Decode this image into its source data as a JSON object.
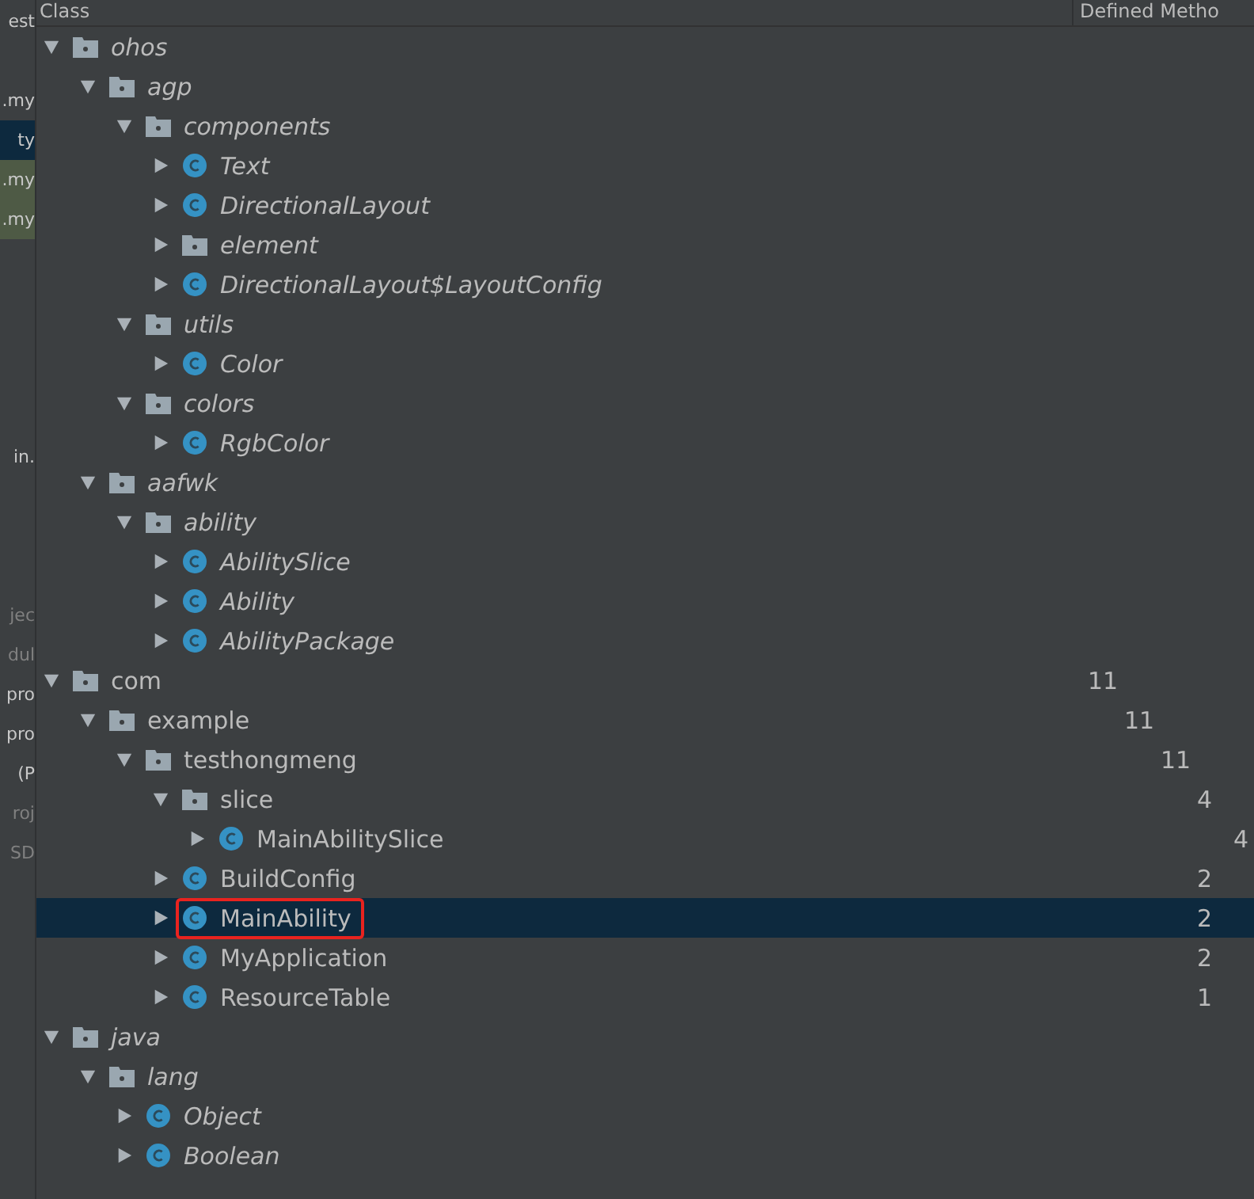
{
  "side_panel": {
    "items": [
      {
        "text": "est",
        "selected": false,
        "modified": false,
        "dim": false
      },
      {
        "text": ".my",
        "selected": false,
        "modified": false,
        "dim": false
      },
      {
        "text": "ty",
        "selected": true,
        "modified": false,
        "dim": false
      },
      {
        "text": ".my",
        "selected": false,
        "modified": true,
        "dim": false
      },
      {
        "text": ".my",
        "selected": false,
        "modified": true,
        "dim": false
      },
      {
        "text": "in.",
        "selected": false,
        "modified": false,
        "dim": false
      },
      {
        "text": "jec",
        "selected": false,
        "modified": false,
        "dim": true
      },
      {
        "text": "dul",
        "selected": false,
        "modified": false,
        "dim": true
      },
      {
        "text": "pro",
        "selected": false,
        "modified": false,
        "dim": false
      },
      {
        "text": "pro",
        "selected": false,
        "modified": false,
        "dim": false
      },
      {
        "text": "(P",
        "selected": false,
        "modified": false,
        "dim": false
      },
      {
        "text": "roj",
        "selected": false,
        "modified": false,
        "dim": true
      },
      {
        "text": "SD",
        "selected": false,
        "modified": false,
        "dim": true
      }
    ]
  },
  "table": {
    "columns": [
      "Class",
      "Defined Metho"
    ],
    "tree": [
      {
        "kind": "package",
        "name": "ohos",
        "italic": true,
        "expanded": true,
        "selected": false,
        "children": [
          {
            "kind": "package",
            "name": "agp",
            "italic": true,
            "expanded": true,
            "selected": false,
            "children": [
              {
                "kind": "package",
                "name": "components",
                "italic": true,
                "expanded": true,
                "selected": false,
                "children": [
                  {
                    "kind": "class",
                    "name": "Text",
                    "italic": true,
                    "expanded": false,
                    "selected": false
                  },
                  {
                    "kind": "class",
                    "name": "DirectionalLayout",
                    "italic": true,
                    "expanded": false,
                    "selected": false
                  },
                  {
                    "kind": "package",
                    "name": "element",
                    "italic": true,
                    "expanded": false,
                    "selected": false
                  },
                  {
                    "kind": "class",
                    "name": "DirectionalLayout$LayoutConfig",
                    "italic": true,
                    "expanded": false,
                    "selected": false
                  }
                ]
              },
              {
                "kind": "package",
                "name": "utils",
                "italic": true,
                "expanded": true,
                "selected": false,
                "children": [
                  {
                    "kind": "class",
                    "name": "Color",
                    "italic": true,
                    "expanded": false,
                    "selected": false
                  }
                ]
              },
              {
                "kind": "package",
                "name": "colors",
                "italic": true,
                "expanded": true,
                "selected": false,
                "children": [
                  {
                    "kind": "class",
                    "name": "RgbColor",
                    "italic": true,
                    "expanded": false,
                    "selected": false
                  }
                ]
              }
            ]
          },
          {
            "kind": "package",
            "name": "aafwk",
            "italic": true,
            "expanded": true,
            "selected": false,
            "children": [
              {
                "kind": "package",
                "name": "ability",
                "italic": true,
                "expanded": true,
                "selected": false,
                "children": [
                  {
                    "kind": "class",
                    "name": "AbilitySlice",
                    "italic": true,
                    "expanded": false,
                    "selected": false
                  },
                  {
                    "kind": "class",
                    "name": "Ability",
                    "italic": true,
                    "expanded": false,
                    "selected": false
                  },
                  {
                    "kind": "class",
                    "name": "AbilityPackage",
                    "italic": true,
                    "expanded": false,
                    "selected": false
                  }
                ]
              }
            ]
          }
        ]
      },
      {
        "kind": "package",
        "name": "com",
        "italic": false,
        "expanded": true,
        "selected": false,
        "count": "11",
        "children": [
          {
            "kind": "package",
            "name": "example",
            "italic": false,
            "expanded": true,
            "selected": false,
            "count": "11",
            "children": [
              {
                "kind": "package",
                "name": "testhongmeng",
                "italic": false,
                "expanded": true,
                "selected": false,
                "count": "11",
                "children": [
                  {
                    "kind": "package",
                    "name": "slice",
                    "italic": false,
                    "expanded": true,
                    "selected": false,
                    "count": "4",
                    "children": [
                      {
                        "kind": "class",
                        "name": "MainAbilitySlice",
                        "italic": false,
                        "expanded": false,
                        "selected": false,
                        "count": "4"
                      }
                    ]
                  },
                  {
                    "kind": "class",
                    "name": "BuildConfig",
                    "italic": false,
                    "expanded": false,
                    "selected": false,
                    "count": "2"
                  },
                  {
                    "kind": "class",
                    "name": "MainAbility",
                    "italic": false,
                    "expanded": false,
                    "selected": true,
                    "outlined": true,
                    "count": "2"
                  },
                  {
                    "kind": "class",
                    "name": "MyApplication",
                    "italic": false,
                    "expanded": false,
                    "selected": false,
                    "count": "2"
                  },
                  {
                    "kind": "class",
                    "name": "ResourceTable",
                    "italic": false,
                    "expanded": false,
                    "selected": false,
                    "count": "1"
                  }
                ]
              }
            ]
          }
        ]
      },
      {
        "kind": "package",
        "name": "java",
        "italic": true,
        "expanded": true,
        "selected": false,
        "children": [
          {
            "kind": "package",
            "name": "lang",
            "italic": true,
            "expanded": true,
            "selected": false,
            "children": [
              {
                "kind": "class",
                "name": "Object",
                "italic": true,
                "expanded": false,
                "selected": false
              },
              {
                "kind": "class",
                "name": "Boolean",
                "italic": true,
                "expanded": false,
                "selected": false
              }
            ]
          }
        ]
      }
    ]
  }
}
